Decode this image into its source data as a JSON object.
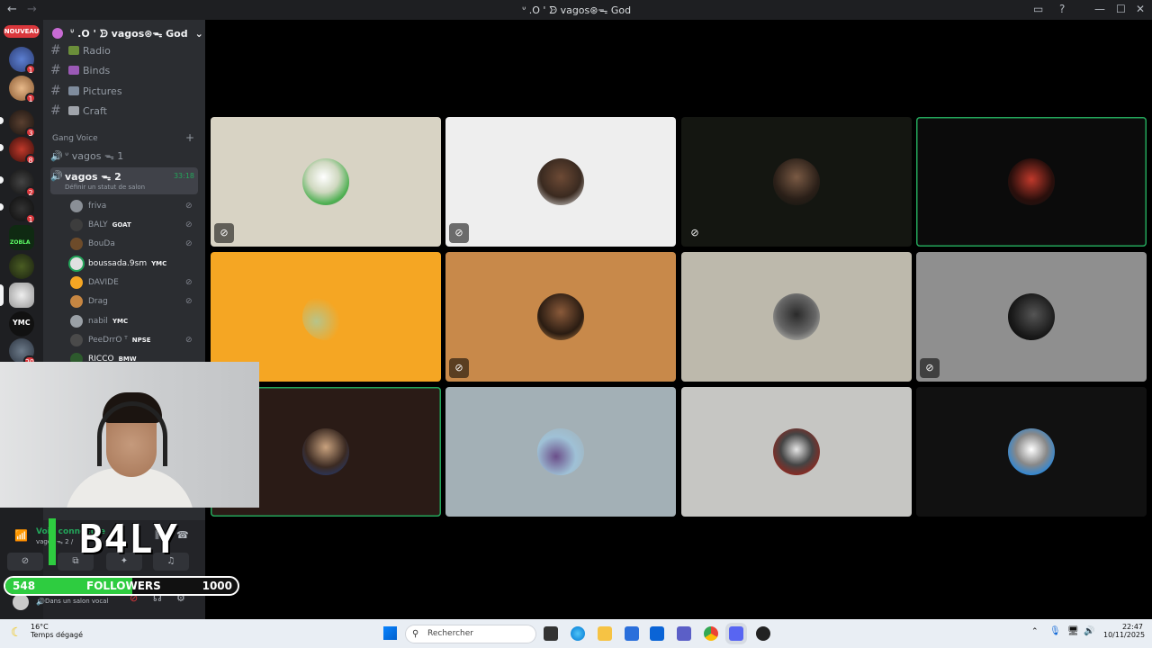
{
  "window": {
    "title": "ᐡ .O ' ᗦ vagos⊛ᯓ God",
    "back_icon": "←",
    "forward_icon": "→"
  },
  "guilds": {
    "new_label": "NOUVEAU",
    "badges": [
      "1",
      "1",
      "3",
      "8",
      "2",
      "1",
      "20"
    ],
    "zoria_label": "ZOBLA",
    "ymc_label": "YMC"
  },
  "server": {
    "name": "ᐡ .O ' ᗦ vagos⊛ᯓ God"
  },
  "text_channels": [
    {
      "label": "Radio"
    },
    {
      "label": "Binds"
    },
    {
      "label": "Pictures"
    },
    {
      "label": "Craft"
    }
  ],
  "category": {
    "label": "Gang Voice"
  },
  "voice_channels": [
    {
      "label": "ᐡ vagos ᯓ 1"
    },
    {
      "label": "vagos ᯓ 2",
      "timer": "33:18",
      "status_hint": "Définir un statut de salon"
    }
  ],
  "voice_users": [
    {
      "name": "friva",
      "tag": ""
    },
    {
      "name": "BALY",
      "tag": "GOAT"
    },
    {
      "name": "BouDa",
      "tag": ""
    },
    {
      "name": "boussada.9sm",
      "tag": "YMC"
    },
    {
      "name": "DAVIDE",
      "tag": ""
    },
    {
      "name": "Drag",
      "tag": ""
    },
    {
      "name": "nabil",
      "tag": "YMC"
    },
    {
      "name": "PeeDrrO ᵀ",
      "tag": "NPSE"
    },
    {
      "name": "RICCO",
      "tag": "BMW"
    }
  ],
  "panel": {
    "voice_connected": "Voix connectée",
    "channel_path": "vagos ᯓ 2 /",
    "user_status": "Dans un salon vocal"
  },
  "overlay": {
    "streamer_name": "B4LY",
    "followers_label": "FOLLOWERS",
    "followers_current": "548",
    "followers_goal": "1000",
    "followers_progress": 0.548
  },
  "taskbar": {
    "temperature": "16°C",
    "weather": "Temps dégagé",
    "search_placeholder": "Rechercher",
    "time": "22:47",
    "date": "10/11/2025"
  },
  "colors": {
    "speaking": "#23a55a",
    "accent_orange": "#f5a623",
    "badge_red": "#da373c"
  }
}
